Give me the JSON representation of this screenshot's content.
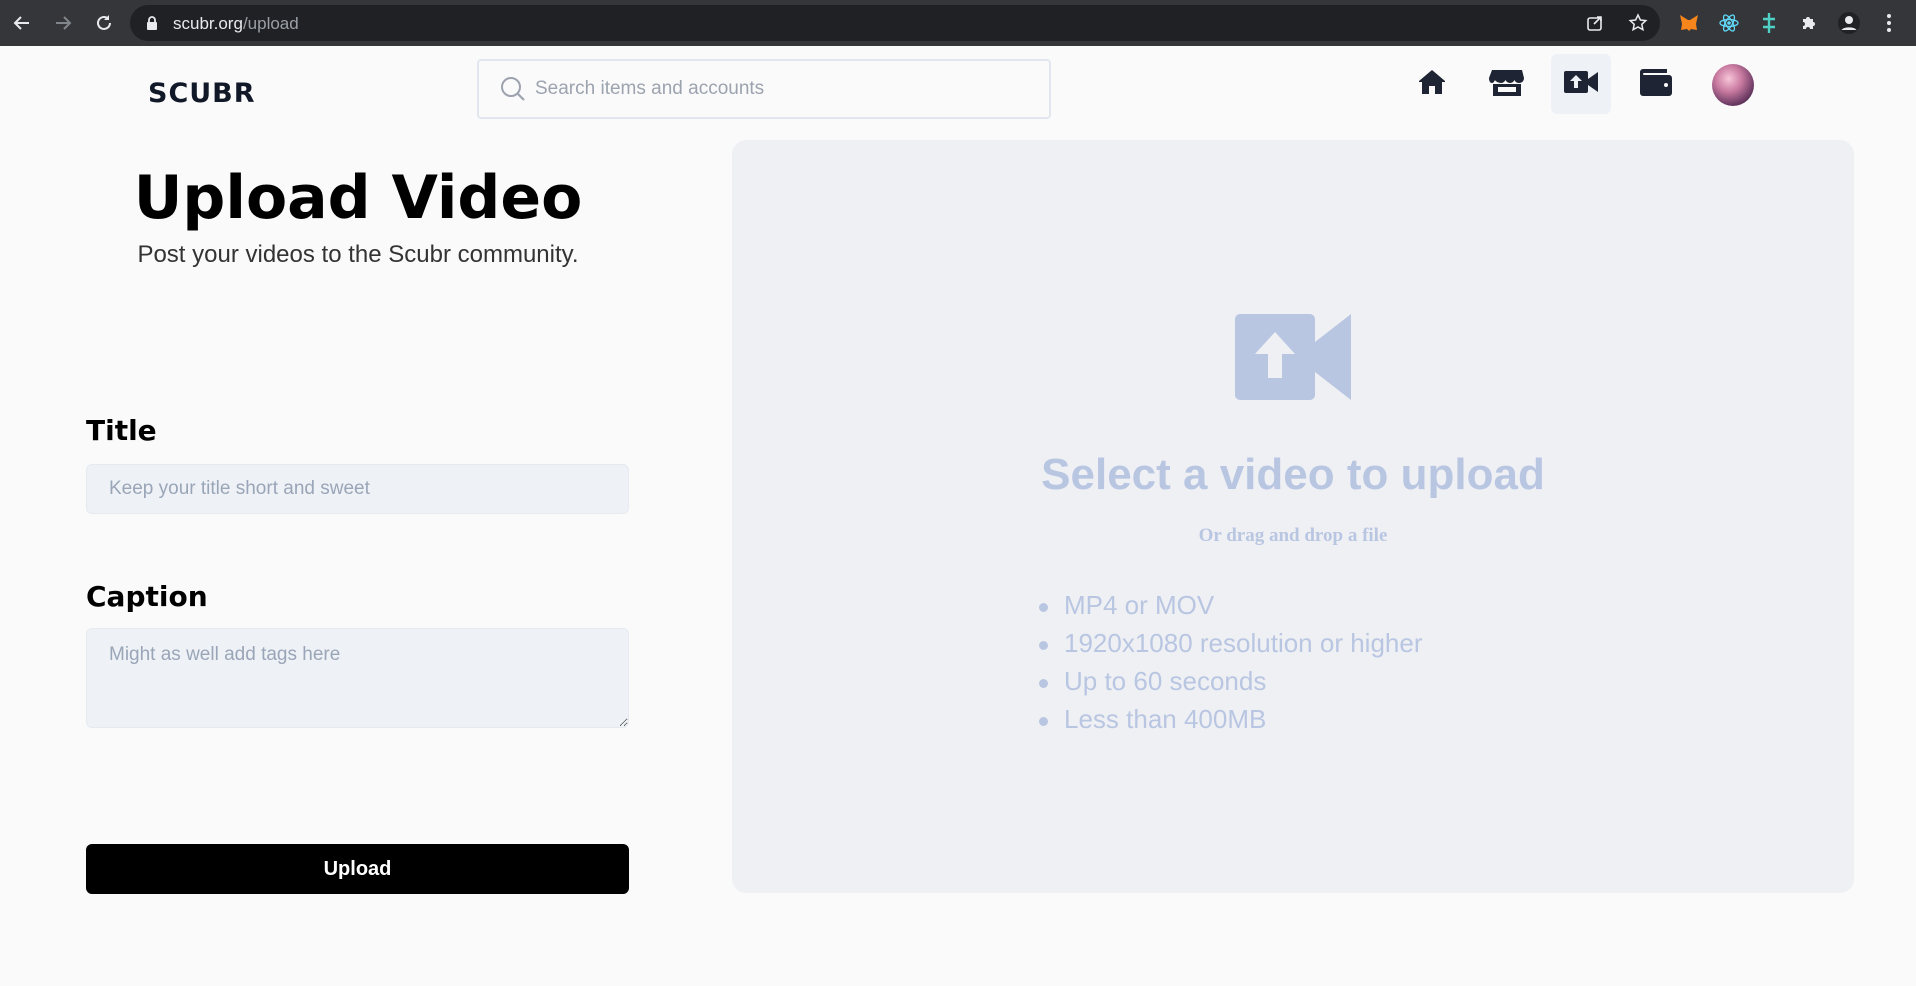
{
  "browser": {
    "url_host": "scubr.org",
    "url_path": "/upload"
  },
  "header": {
    "logo": "SCUBR",
    "search_placeholder": "Search items and accounts",
    "nav_icons": [
      "home-icon",
      "store-icon",
      "upload-video-icon",
      "wallet-icon"
    ],
    "active_nav": "upload-video-icon"
  },
  "form": {
    "heading": "Upload Video",
    "subheading": "Post your videos to the Scubr community.",
    "title_label": "Title",
    "title_placeholder": "Keep your title short and sweet",
    "caption_label": "Caption",
    "caption_placeholder": "Might as well add tags here",
    "upload_label": "Upload"
  },
  "dropzone": {
    "icon": "video-upload-icon",
    "title": "Select a video to upload",
    "subtitle": "Or drag and drop a file",
    "requirements": [
      "MP4 or MOV",
      "1920x1080 resolution or higher",
      "Up to 60 seconds",
      "Less than 400MB"
    ]
  },
  "colors": {
    "accent_muted": "#b9c6e2",
    "button_bg": "#000000",
    "dropzone_bg": "#eff0f4"
  }
}
